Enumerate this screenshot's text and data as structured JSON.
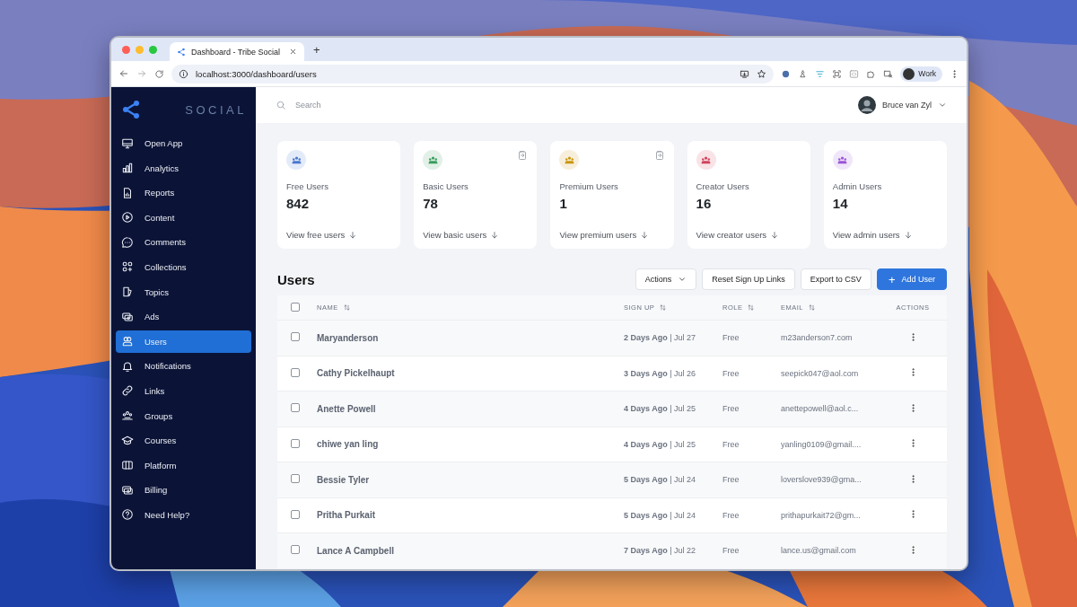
{
  "browser": {
    "tab_title": "Dashboard - Tribe Social",
    "new_tab": "+",
    "url": "localhost:3000/dashboard/users",
    "profile": "Work"
  },
  "sidebar": {
    "logo": "SOCIAL",
    "items": [
      {
        "label": "Open App",
        "selected": false
      },
      {
        "label": "Analytics",
        "selected": false
      },
      {
        "label": "Reports",
        "selected": false
      },
      {
        "label": "Content",
        "selected": false
      },
      {
        "label": "Comments",
        "selected": false
      },
      {
        "label": "Collections",
        "selected": false
      },
      {
        "label": "Topics",
        "selected": false
      },
      {
        "label": "Ads",
        "selected": false
      },
      {
        "label": "Users",
        "selected": true
      },
      {
        "label": "Notifications",
        "selected": false
      },
      {
        "label": "Links",
        "selected": false
      },
      {
        "label": "Groups",
        "selected": false
      },
      {
        "label": "Courses",
        "selected": false
      },
      {
        "label": "Platform",
        "selected": false
      },
      {
        "label": "Billing",
        "selected": false
      },
      {
        "label": "Need Help?",
        "selected": false
      }
    ]
  },
  "topbar": {
    "search": {
      "placeholder": "Search"
    },
    "user_name": "Bruce van Zyl"
  },
  "stats": [
    {
      "label": "Free Users",
      "value": "842",
      "link": "View free users",
      "color": "#4a78d0",
      "action_icon": false
    },
    {
      "label": "Basic Users",
      "value": "78",
      "link": "View basic users",
      "color": "#3a9d5d",
      "action_icon": true
    },
    {
      "label": "Premium Users",
      "value": "1",
      "link": "View premium users",
      "color": "#c9960c",
      "action_icon": true
    },
    {
      "label": "Creator Users",
      "value": "16",
      "link": "View creator users",
      "color": "#d0435b",
      "action_icon": false
    },
    {
      "label": "Admin Users",
      "value": "14",
      "link": "View admin users",
      "color": "#9a55d8",
      "action_icon": false
    }
  ],
  "users": {
    "title": "Users",
    "buttons": [
      {
        "kind": "dropdown",
        "label": "Actions"
      },
      {
        "kind": "plain",
        "label": "Reset Sign Up Links"
      },
      {
        "kind": "plain",
        "label": "Export to CSV"
      },
      {
        "kind": "primary",
        "label": "Add User",
        "icon": "+"
      }
    ],
    "table": {
      "all_checked": false,
      "columns": [
        {
          "label": "NAME",
          "sortable": true
        },
        {
          "label": "SIGN UP",
          "sortable": true
        },
        {
          "label": "ROLE",
          "sortable": true
        },
        {
          "label": "EMAIL",
          "sortable": true
        },
        {
          "label": "ACTIONS",
          "sortable": false
        }
      ],
      "rows": [
        {
          "checked": false,
          "name": "Maryanderson",
          "sign_up": "**2 Days Ago** | Jul 27",
          "role": "Free",
          "email": "m23anderson7.com"
        },
        {
          "checked": false,
          "name": "Cathy Pickelhaupt",
          "sign_up": "**3 Days Ago** | Jul 26",
          "role": "Free",
          "email": "seepick047@aol.com"
        },
        {
          "checked": false,
          "name": "Anette Powell",
          "sign_up": "**4 Days Ago** | Jul 25",
          "role": "Free",
          "email": "anettepowell@aol.c..."
        },
        {
          "checked": false,
          "name": "chiwe yan ling",
          "sign_up": "**4 Days Ago** | Jul 25",
          "role": "Free",
          "email": "yanling0109@gmail...."
        },
        {
          "checked": false,
          "name": "Bessie Tyler",
          "sign_up": "**5 Days Ago** | Jul 24",
          "role": "Free",
          "email": "loverslove939@gma..."
        },
        {
          "checked": false,
          "name": "Pritha Purkait",
          "sign_up": "**5 Days Ago** | Jul 24",
          "role": "Free",
          "email": "prithapurkait72@gm..."
        },
        {
          "checked": false,
          "name": "Lance A Campbell",
          "sign_up": "**7 Days Ago** | Jul 22",
          "role": "Free",
          "email": "lance.us@gmail.com"
        }
      ]
    }
  }
}
